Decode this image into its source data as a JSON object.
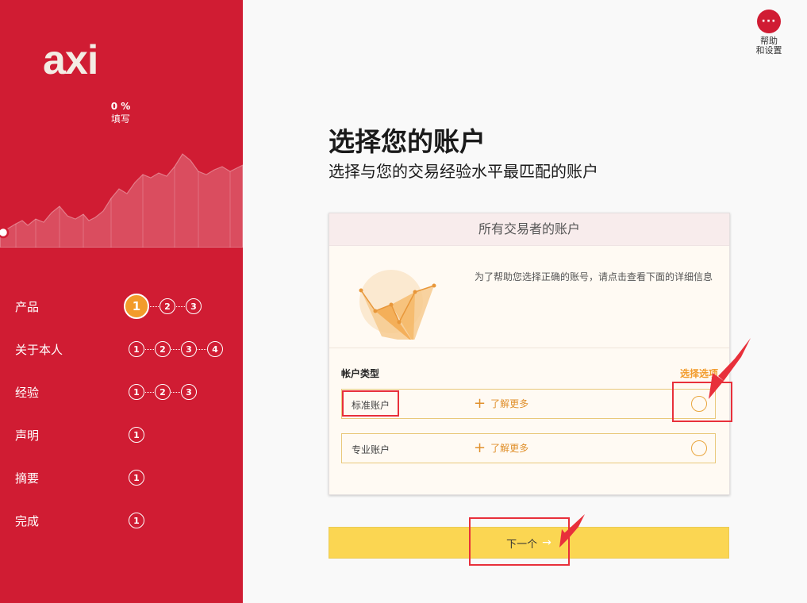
{
  "sidebar": {
    "logo": "axi",
    "progress_percent": "0 %",
    "progress_label": "填写",
    "steps": [
      {
        "label": "产品",
        "dots": [
          "1",
          "2",
          "3"
        ],
        "active": 0
      },
      {
        "label": "关于本人",
        "dots": [
          "1",
          "2",
          "3",
          "4"
        ]
      },
      {
        "label": "经验",
        "dots": [
          "1",
          "2",
          "3"
        ]
      },
      {
        "label": "声明",
        "dots": [
          "1"
        ]
      },
      {
        "label": "摘要",
        "dots": [
          "1"
        ]
      },
      {
        "label": "完成",
        "dots": [
          "1"
        ]
      }
    ]
  },
  "help": {
    "label_line1": "帮助",
    "label_line2": "和设置",
    "icon": "more-icon"
  },
  "main": {
    "title": "选择您的账户",
    "subtitle": "选择与您的交易经验水平最匹配的账户",
    "card": {
      "header": "所有交易者的账户",
      "intro": "为了帮助您选择正确的账号，请点击查看下面的详细信息",
      "account_type_label": "帐户类型",
      "choose_label": "选择选项",
      "options": [
        {
          "name": "标准账户",
          "more": "了解更多"
        },
        {
          "name": "专业账户",
          "more": "了解更多"
        }
      ]
    },
    "next_label": "下一个"
  },
  "colors": {
    "brand_red": "#d01c33",
    "accent_orange": "#f29b2b",
    "button_yellow": "#fbd652",
    "annotation_red": "#e8303b"
  }
}
